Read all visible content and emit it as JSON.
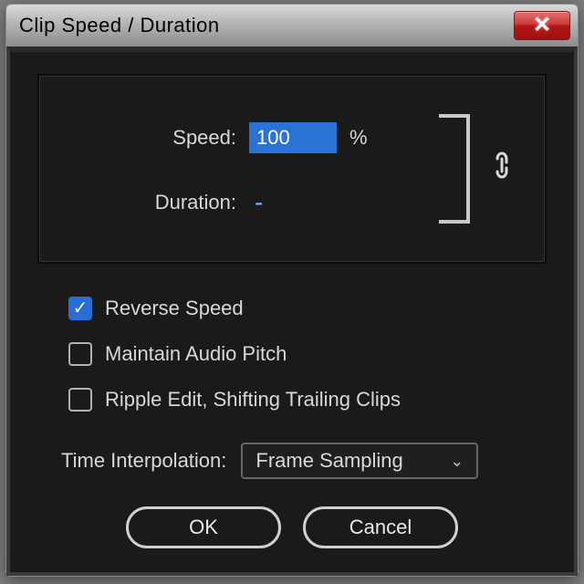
{
  "window": {
    "title": "Clip Speed / Duration"
  },
  "fields": {
    "speed_label": "Speed:",
    "speed_value": "100",
    "speed_unit": "%",
    "duration_label": "Duration:",
    "duration_value": "-"
  },
  "checkboxes": {
    "reverse": {
      "label": "Reverse Speed",
      "checked": true
    },
    "pitch": {
      "label": "Maintain Audio Pitch",
      "checked": false
    },
    "ripple": {
      "label": "Ripple Edit, Shifting Trailing Clips",
      "checked": false
    }
  },
  "interp": {
    "label": "Time Interpolation:",
    "value": "Frame Sampling"
  },
  "buttons": {
    "ok": "OK",
    "cancel": "Cancel"
  }
}
